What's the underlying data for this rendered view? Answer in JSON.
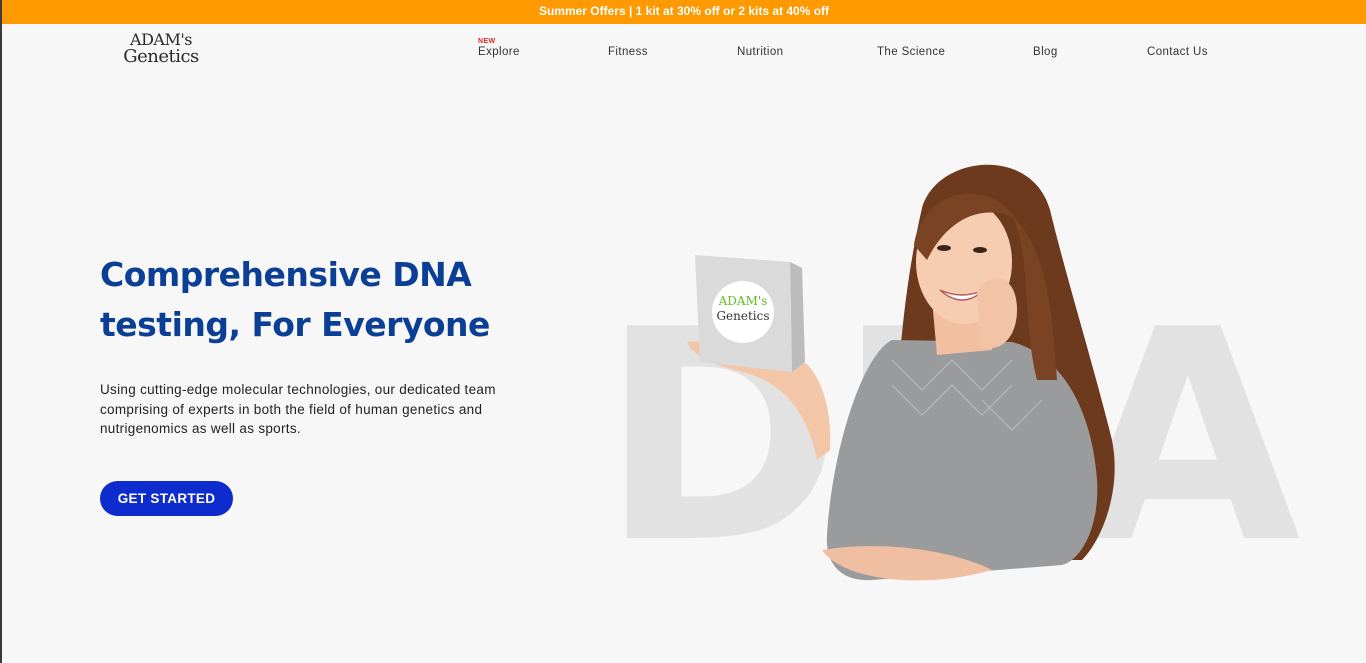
{
  "promo": {
    "text": "Summer Offers | 1 kit at 30% off or 2 kits at 40% off",
    "background": "#fe9a00"
  },
  "brand": {
    "line1": "ADAM's",
    "line2": "Genetics"
  },
  "nav": {
    "items": [
      {
        "label": "Explore",
        "badge": "NEW"
      },
      {
        "label": "Fitness"
      },
      {
        "label": "Nutrition"
      },
      {
        "label": "The Science"
      },
      {
        "label": "Blog"
      },
      {
        "label": "Contact Us"
      }
    ]
  },
  "hero": {
    "headline_line1": "Comprehensive DNA",
    "headline_line2": "testing, For Everyone",
    "description": "Using cutting-edge molecular technologies, our dedicated team comprising of experts in both the field of human genetics and nutrigenomics as well as sports.",
    "cta_label": "GET STARTED",
    "backdrop_text": "DNA",
    "kit_brand_line1": "ADAM's",
    "kit_brand_line2": "Genetics",
    "headline_color": "#0b3f96",
    "cta_color": "#0e2ccd"
  }
}
